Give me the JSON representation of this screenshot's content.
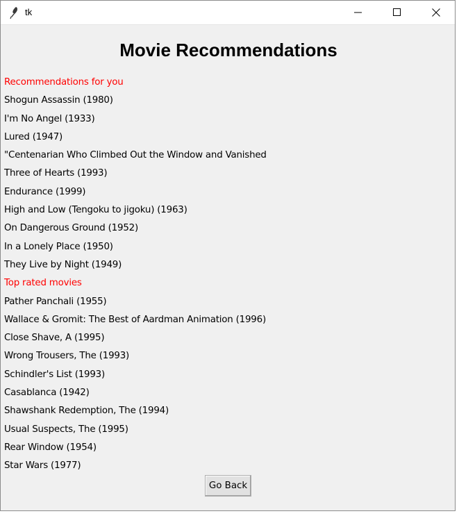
{
  "window": {
    "title": "tk",
    "icon": "feather-icon"
  },
  "heading": "Movie Recommendations",
  "recommendations": {
    "label": "Recommendations for you",
    "items": [
      "Shogun Assassin (1980)",
      "I'm No Angel (1933)",
      "Lured (1947)",
      "\"Centenarian Who Climbed Out the Window and Vanished",
      "Three of Hearts (1993)",
      "Endurance (1999)",
      "High and Low (Tengoku to jigoku) (1963)",
      "On Dangerous Ground (1952)",
      "In a Lonely Place (1950)",
      "They Live by Night (1949)"
    ]
  },
  "top_rated": {
    "label": "Top rated movies",
    "items": [
      "Pather Panchali (1955)",
      "Wallace & Gromit: The Best of Aardman Animation (1996)",
      "Close Shave, A (1995)",
      "Wrong Trousers, The (1993)",
      "Schindler's List (1993)",
      "Casablanca (1942)",
      "Shawshank Redemption, The (1994)",
      "Usual Suspects, The (1995)",
      "Rear Window (1954)",
      "Star Wars (1977)"
    ]
  },
  "buttons": {
    "go_back": "Go Back"
  },
  "colors": {
    "section_label": "#ff0000",
    "window_bg": "#f0f0f0"
  }
}
